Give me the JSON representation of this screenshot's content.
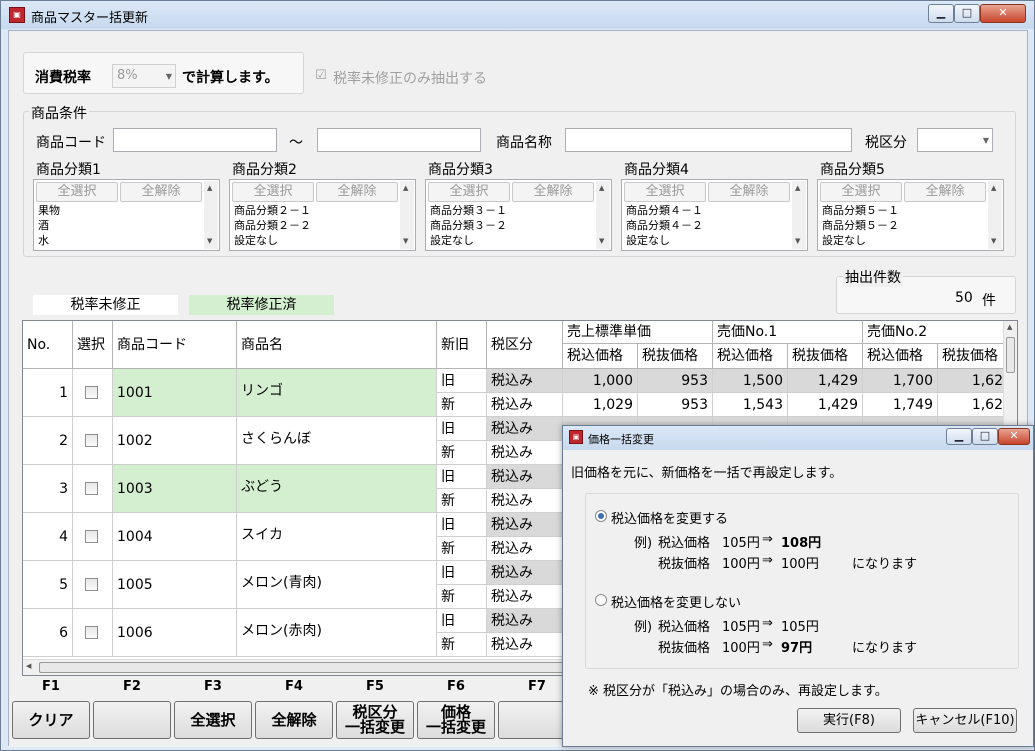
{
  "window": {
    "title": "商品マスター括更新",
    "app_icon": "商品マスター",
    "buttons": {
      "minimize": "▁",
      "maximize": "□",
      "close": "✕"
    }
  },
  "tax": {
    "label": "消費税率",
    "rate": "8%",
    "suffix": "で計算します。",
    "checkbox_label": "税率未修正のみ抽出する",
    "checkbox_checked": true
  },
  "conditions": {
    "group_title": "商品条件",
    "code_label": "商品コード",
    "range_sep": "～",
    "name_label": "商品名称",
    "tax_class_label": "税区分",
    "select_all": "全選択",
    "deselect_all": "全解除",
    "categories": [
      {
        "label": "商品分類1",
        "items": [
          "果物",
          "酒",
          "水"
        ]
      },
      {
        "label": "商品分類2",
        "items": [
          "商品分類２－１",
          "商品分類２－２",
          "設定なし"
        ]
      },
      {
        "label": "商品分類3",
        "items": [
          "商品分類３－１",
          "商品分類３－２",
          "設定なし"
        ]
      },
      {
        "label": "商品分類4",
        "items": [
          "商品分類４－１",
          "商品分類４－２",
          "設定なし"
        ]
      },
      {
        "label": "商品分類5",
        "items": [
          "商品分類５－１",
          "商品分類５－２",
          "設定なし"
        ]
      }
    ]
  },
  "legend": {
    "unmodified": "税率未修正",
    "modified": "税率修正済",
    "unmodified_color": "#ffffff",
    "modified_color": "#d3efcf"
  },
  "count": {
    "label": "抽出件数",
    "value": "50",
    "unit": "件"
  },
  "table": {
    "headers": {
      "no": "No.",
      "select": "選択",
      "code": "商品コード",
      "name": "商品名",
      "newold": "新旧",
      "taxclass": "税区分",
      "group1": "売上標準単価",
      "group2": "売価No.1",
      "group3": "売価No.2",
      "incl": "税込価格",
      "excl": "税抜価格"
    },
    "rows": [
      {
        "no": "1",
        "code": "1001",
        "name": "リンゴ",
        "modified": true,
        "old": {
          "kind": "旧",
          "tax": "税込み",
          "p": [
            "1,000",
            "953",
            "1,500",
            "1,429",
            "1,700",
            "1,62"
          ]
        },
        "new": {
          "kind": "新",
          "tax": "税込み",
          "p": [
            "1,029",
            "953",
            "1,543",
            "1,429",
            "1,749",
            "1,62"
          ]
        }
      },
      {
        "no": "2",
        "code": "1002",
        "name": "さくらんぼ",
        "modified": false,
        "old": {
          "kind": "旧",
          "tax": "税込み",
          "p": [
            "",
            "",
            "",
            "",
            "",
            ""
          ]
        },
        "new": {
          "kind": "新",
          "tax": "税込み",
          "p": [
            "",
            "",
            "",
            "",
            "",
            ""
          ]
        }
      },
      {
        "no": "3",
        "code": "1003",
        "name": "ぶどう",
        "modified": true,
        "old": {
          "kind": "旧",
          "tax": "税込み",
          "p": [
            "",
            "",
            "",
            "",
            "",
            ""
          ]
        },
        "new": {
          "kind": "新",
          "tax": "税込み",
          "p": [
            "",
            "",
            "",
            "",
            "",
            ""
          ]
        }
      },
      {
        "no": "4",
        "code": "1004",
        "name": "スイカ",
        "modified": false,
        "old": {
          "kind": "旧",
          "tax": "税込み",
          "p": [
            "",
            "",
            "",
            "",
            "",
            ""
          ]
        },
        "new": {
          "kind": "新",
          "tax": "税込み",
          "p": [
            "",
            "",
            "",
            "",
            "",
            ""
          ]
        }
      },
      {
        "no": "5",
        "code": "1005",
        "name": "メロン(青肉)",
        "modified": false,
        "old": {
          "kind": "旧",
          "tax": "税込み",
          "p": [
            "",
            "",
            "",
            "",
            "",
            ""
          ]
        },
        "new": {
          "kind": "新",
          "tax": "税込み",
          "p": [
            "",
            "",
            "",
            "",
            "",
            ""
          ]
        }
      },
      {
        "no": "6",
        "code": "1006",
        "name": "メロン(赤肉)",
        "modified": false,
        "old": {
          "kind": "旧",
          "tax": "税込み",
          "p": [
            "",
            "",
            "",
            "",
            "",
            ""
          ]
        },
        "new": {
          "kind": "新",
          "tax": "税込み",
          "p": [
            "",
            "",
            "",
            "",
            "",
            ""
          ]
        }
      }
    ]
  },
  "fkeys": [
    {
      "key": "F1",
      "label": "クリア"
    },
    {
      "key": "F2",
      "label": ""
    },
    {
      "key": "F3",
      "label": "全選択"
    },
    {
      "key": "F4",
      "label": "全解除"
    },
    {
      "key": "F5",
      "label": "税区分\n一括変更"
    },
    {
      "key": "F6",
      "label": "価格\n一括変更"
    },
    {
      "key": "F7",
      "label": ""
    }
  ],
  "dialog": {
    "title": "価格一括変更",
    "intro": "旧価格を元に、新価格を一括で再設定します。",
    "option1": {
      "label": "税込価格を変更する",
      "selected": true,
      "ex_prefix": "例)",
      "line1": {
        "kind": "税込価格",
        "old": "105円",
        "arrow": "⇒",
        "new": "108円"
      },
      "line2": {
        "kind": "税抜価格",
        "old": "100円",
        "arrow": "⇒",
        "new": "100円"
      },
      "result": "になります"
    },
    "option2": {
      "label": "税込価格を変更しない",
      "selected": false,
      "ex_prefix": "例)",
      "line1": {
        "kind": "税込価格",
        "old": "105円",
        "arrow": "⇒",
        "new": "105円"
      },
      "line2": {
        "kind": "税抜価格",
        "old": "100円",
        "arrow": "⇒",
        "new": "97円"
      },
      "result": "になります"
    },
    "note": "※ 税区分が「税込み」の場合のみ、再設定します。",
    "ok": "実行(F8)",
    "cancel": "キャンセル(F10)"
  }
}
